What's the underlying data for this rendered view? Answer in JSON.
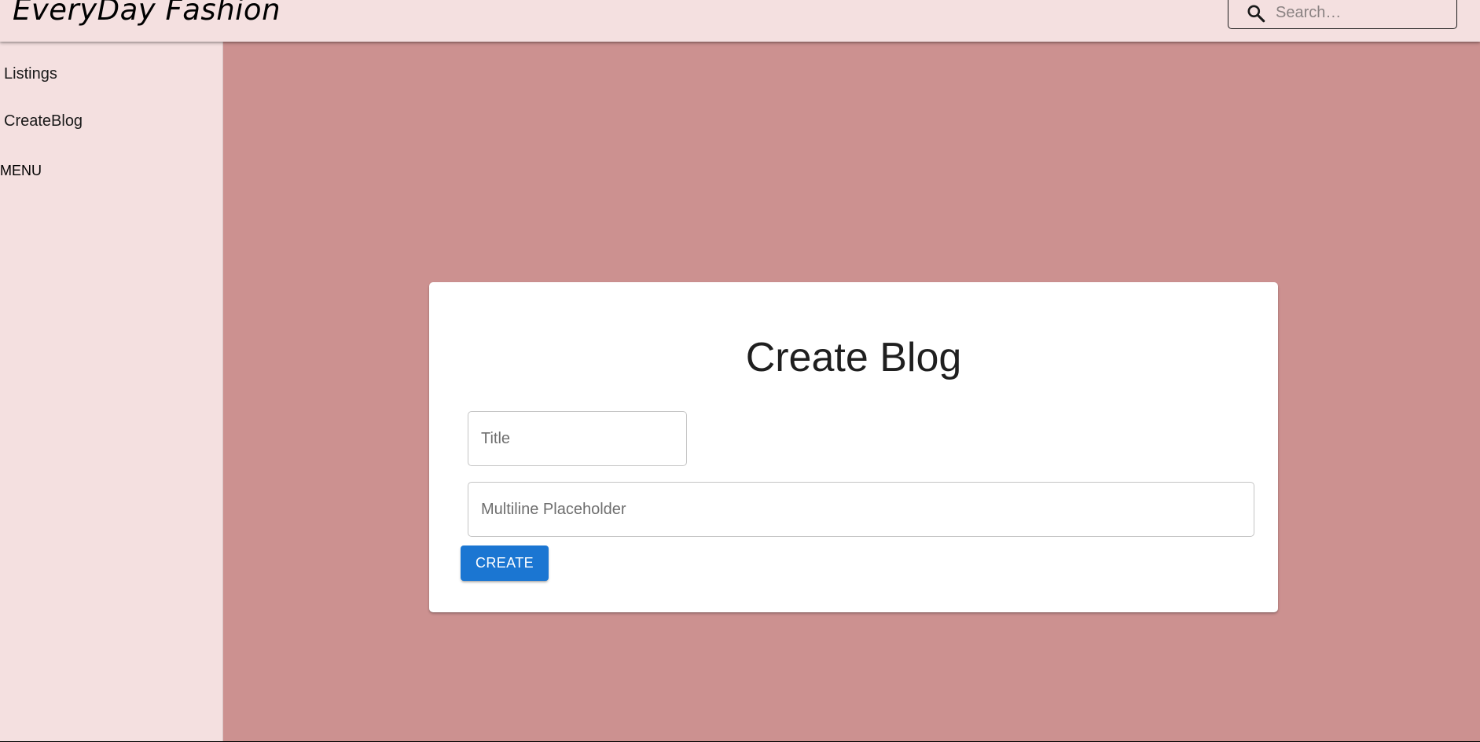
{
  "header": {
    "brand": "EveryDay Fashion",
    "search": {
      "placeholder": "Search…",
      "value": ""
    }
  },
  "sidebar": {
    "items": [
      {
        "label": "Listings"
      },
      {
        "label": "CreateBlog"
      }
    ],
    "menu_label": "MENU"
  },
  "form": {
    "title": "Create Blog",
    "title_field": {
      "placeholder": "Title",
      "value": ""
    },
    "body_field": {
      "placeholder": "Multiline Placeholder",
      "value": ""
    },
    "submit_label": "CREATE"
  },
  "colors": {
    "page_background": "#cc9190",
    "bar_background": "#f4e0e0",
    "button_primary": "#1b76d2"
  },
  "icons": {
    "search": "search-icon"
  }
}
